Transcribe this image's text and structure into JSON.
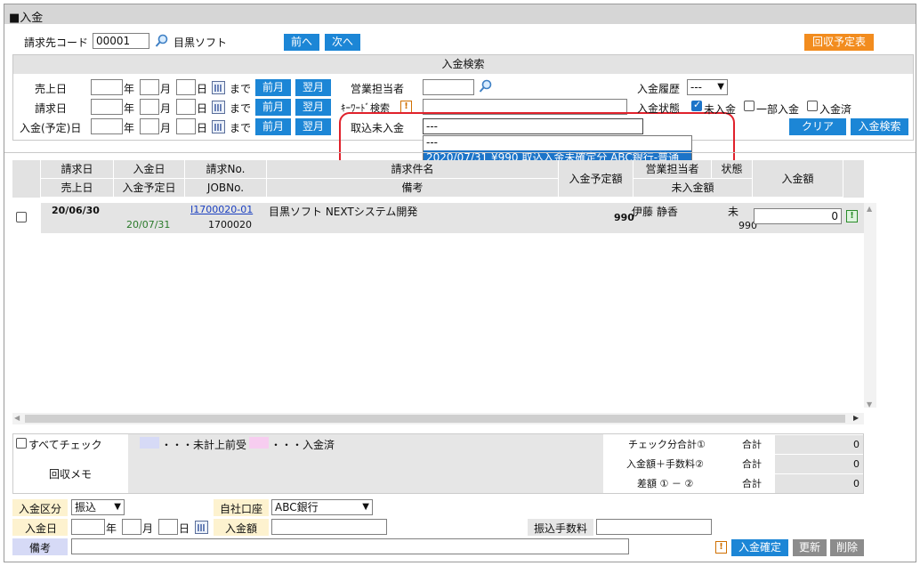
{
  "page": {
    "title": "■入金"
  },
  "topbar": {
    "customer_code_label": "請求先コード",
    "customer_code": "00001",
    "customer_name": "目黒ソフト",
    "prev_label": "前へ",
    "next_label": "次へ",
    "schedule_label": "回収予定表"
  },
  "search": {
    "title": "入金検索",
    "rows": [
      {
        "label": "売上日"
      },
      {
        "label": "請求日"
      },
      {
        "label": "入金(予定)日"
      }
    ],
    "year": "年",
    "month": "月",
    "day": "日",
    "until": "まで",
    "prev_month": "前月",
    "next_month": "翌月",
    "sales_rep_label": "営業担当者",
    "keyword_label": "ｷｰﾜｰﾄﾞ検索",
    "unposted_label": "取込未入金",
    "unposted_value": "---",
    "dropdown_options": [
      "---",
      "2020/07/31 ¥990 取込入金未確定分 ABC銀行-普通"
    ],
    "history_label": "入金履歴",
    "history_value": "---",
    "status_label": "入金状態",
    "status_options": [
      "未入金",
      "一部入金",
      "入金済"
    ],
    "clear_label": "クリア",
    "search_label": "入金検索"
  },
  "table": {
    "headers": {
      "billing_date": "請求日",
      "payment_date": "入金日",
      "invoice_no": "請求No.",
      "subject": "請求件名",
      "sales_date": "売上日",
      "planned_date": "入金予定日",
      "job_no": "JOBNo.",
      "remarks": "備考",
      "planned_amount": "入金予定額",
      "sales_rep": "営業担当者",
      "status": "状態",
      "unpaid": "未入金額",
      "amount": "入金額"
    },
    "rows": [
      {
        "billing_date": "20/06/30",
        "planned_date": "20/07/31",
        "invoice_no": "I1700020-01",
        "job_no": "1700020",
        "subject": "目黒ソフト NEXTシステム開発",
        "planned_amount": "990",
        "sales_rep": "伊藤 静香",
        "status": "未",
        "unpaid": "990",
        "amount": "0"
      }
    ]
  },
  "footer": {
    "check_all": "すべてチェック",
    "legend_unrecorded": "・・・未計上前受",
    "legend_paid": "・・・入金済",
    "memo_label": "回収メモ",
    "checked_total_label": "チェック分合計①",
    "fee_total_label": "入金額＋手数料②",
    "diff_label": "差額 ① － ②",
    "total_label": "合計",
    "checked_total": "0",
    "fee_total": "0",
    "diff": "0",
    "type_label": "入金区分",
    "type_value": "振込",
    "account_label": "自社口座",
    "account_value": "ABC銀行",
    "date_label": "入金日",
    "amount_label": "入金額",
    "fee_label": "振込手数料",
    "remarks_label": "備考",
    "confirm_label": "入金確定",
    "update_label": "更新",
    "delete_label": "削除"
  },
  "colors": {
    "blue_button": "#1c86d6",
    "orange_button": "#f28c1e",
    "legend_unrecorded": "#d6daf6",
    "legend_paid": "#f7cdf0",
    "highlight": "#e0212b"
  }
}
